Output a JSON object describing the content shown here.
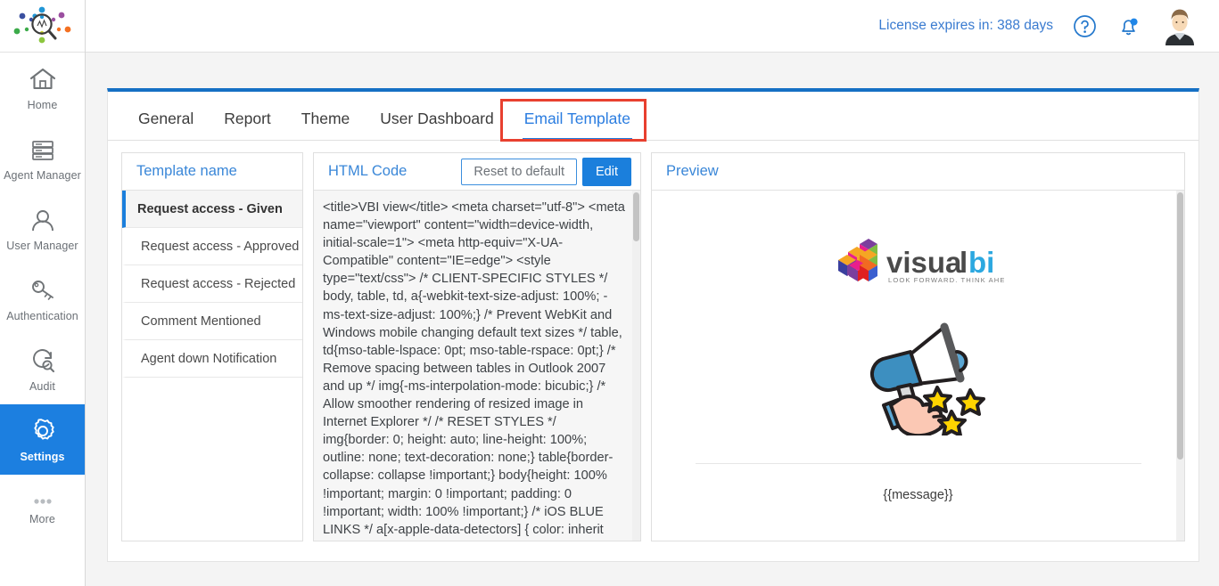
{
  "sidebar": {
    "logo_icon": "magnifier-analytics-logo",
    "items": [
      {
        "label": "Home",
        "icon": "home-icon",
        "active": false
      },
      {
        "label": "Agent Manager",
        "icon": "server-stack-icon",
        "active": false
      },
      {
        "label": "User Manager",
        "icon": "user-icon",
        "active": false
      },
      {
        "label": "Authentication",
        "icon": "key-icon",
        "active": false
      },
      {
        "label": "Audit",
        "icon": "audit-search-icon",
        "active": false
      },
      {
        "label": "Settings",
        "icon": "gear-icon",
        "active": true
      },
      {
        "label": "More",
        "icon": "ellipsis-icon",
        "active": false
      }
    ]
  },
  "topbar": {
    "license_text": "License expires in: 388 days",
    "help_icon": "question-circle-icon",
    "notification_icon": "bell-icon",
    "avatar_icon": "user-avatar",
    "accent_color": "#3a7bd0"
  },
  "tabs": [
    {
      "label": "General",
      "active": false
    },
    {
      "label": "Report",
      "active": false
    },
    {
      "label": "Theme",
      "active": false
    },
    {
      "label": "User Dashboard",
      "active": false
    },
    {
      "label": "Email Template",
      "active": true
    }
  ],
  "highlight": {
    "color": "#e8402f",
    "target": "Email Template"
  },
  "template_panel": {
    "title": "Template name",
    "items": [
      {
        "label": "Request access - Given",
        "selected": true
      },
      {
        "label": "Request access - Approved",
        "selected": false
      },
      {
        "label": "Request access - Rejected",
        "selected": false
      },
      {
        "label": "Comment Mentioned",
        "selected": false
      },
      {
        "label": "Agent down Notification",
        "selected": false
      }
    ]
  },
  "html_panel": {
    "title": "HTML Code",
    "reset_label": "Reset to default",
    "edit_label": "Edit",
    "code": "<title>VBI view</title> <meta charset=\"utf-8\"> <meta name=\"viewport\" content=\"width=device-width, initial-scale=1\"> <meta http-equiv=\"X-UA-Compatible\" content=\"IE=edge\"> <style type=\"text/css\"> /* CLIENT-SPECIFIC STYLES */ body, table, td, a{-webkit-text-size-adjust: 100%; -ms-text-size-adjust: 100%;} /* Prevent WebKit and Windows mobile changing default text sizes */ table, td{mso-table-lspace: 0pt; mso-table-rspace: 0pt;} /* Remove spacing between tables in Outlook 2007 and up */ img{-ms-interpolation-mode: bicubic;} /* Allow smoother rendering of resized image in Internet Explorer */ /* RESET STYLES */ img{border: 0; height: auto; line-height: 100%; outline: none; text-decoration: none;} table{border-collapse: collapse !important;} body{height: 100% !important; margin: 0 !important; padding: 0 !important; width: 100% !important;} /* iOS BLUE LINKS */ a[x-apple-data-detectors] { color: inherit !important; text-decoration: none !important; font-size: inherit !important; font"
  },
  "preview_panel": {
    "title": "Preview",
    "logo_text": "visualbi",
    "logo_tagline": "LOOK FORWARD. THINK AHEAD.",
    "illustration": "megaphone-with-stars",
    "message_placeholder": "{{message}}"
  },
  "colors": {
    "brand_blue": "#1b7fdc",
    "page_background": "#f4f4f4",
    "card_top_border": "#1570c4",
    "highlight_red": "#e8402f"
  }
}
